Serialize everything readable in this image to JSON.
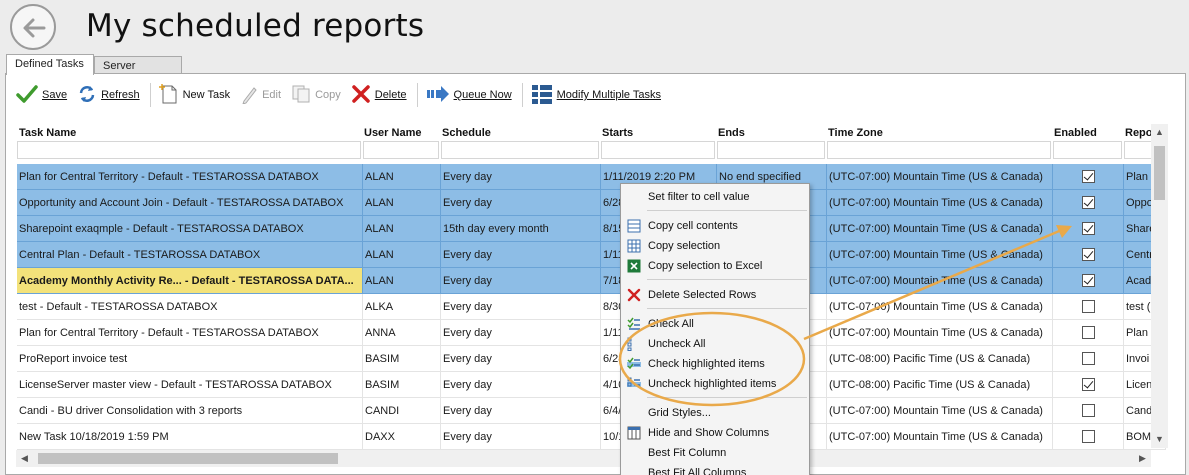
{
  "title": "My scheduled reports",
  "tabs": [
    {
      "label": "Defined Tasks",
      "active": true
    },
    {
      "label": "Server Control",
      "active": false
    }
  ],
  "toolbar": {
    "save": "Save",
    "refresh": "Refresh",
    "new_task": "New Task",
    "edit": "Edit",
    "copy": "Copy",
    "delete": "Delete",
    "queue_now": "Queue Now",
    "modify_multiple": "Modify Multiple Tasks"
  },
  "columns": {
    "task_name": "Task Name",
    "user_name": "User Name",
    "schedule": "Schedule",
    "starts": "Starts",
    "ends": "Ends",
    "time_zone": "Time Zone",
    "enabled": "Enabled",
    "report": "Repo"
  },
  "rows": [
    {
      "task": "Plan for Central Territory - Default - TESTAROSSA DATABOX",
      "user": "ALAN",
      "schedule": "Every day",
      "starts": "1/11/2019 2:20 PM",
      "ends": "No end specified",
      "tz": "(UTC-07:00) Mountain Time (US & Canada)",
      "enabled": true,
      "report": "Plan f",
      "selected": true,
      "focus": false
    },
    {
      "task": "Opportunity and Account Join - Default - TESTAROSSA DATABOX",
      "user": "ALAN",
      "schedule": "Every day",
      "starts": "6/28",
      "ends": "",
      "tz": "(UTC-07:00) Mountain Time (US & Canada)",
      "enabled": true,
      "report": "Oppo",
      "selected": true,
      "focus": false
    },
    {
      "task": "Sharepoint exaqmple - Default - TESTAROSSA DATABOX",
      "user": "ALAN",
      "schedule": "15th day every month",
      "starts": "8/15",
      "ends": "",
      "tz": "(UTC-07:00) Mountain Time (US & Canada)",
      "enabled": true,
      "report": "Share",
      "selected": true,
      "focus": false
    },
    {
      "task": "Central Plan - Default - TESTAROSSA DATABOX",
      "user": "ALAN",
      "schedule": "Every day",
      "starts": "1/11",
      "ends": "",
      "tz": "(UTC-07:00) Mountain Time (US & Canada)",
      "enabled": true,
      "report": "Centr",
      "selected": true,
      "focus": false
    },
    {
      "task": "Academy Monthly Activity Re... - Default - TESTAROSSA DATA...",
      "user": "ALAN",
      "schedule": "Every day",
      "starts": "7/18",
      "ends": "",
      "tz": "(UTC-07:00) Mountain Time (US & Canada)",
      "enabled": true,
      "report": "Acad",
      "selected": true,
      "focus": true
    },
    {
      "task": "test - Default - TESTAROSSA DATABOX",
      "user": "ALKA",
      "schedule": "Every day",
      "starts": "8/30",
      "ends": "",
      "tz": "(UTC-07:00) Mountain Time (US & Canada)",
      "enabled": false,
      "report": "test (",
      "selected": false,
      "focus": false
    },
    {
      "task": "Plan for Central Territory - Default - TESTAROSSA DATABOX",
      "user": "ANNA",
      "schedule": "Every day",
      "starts": "1/11",
      "ends": "",
      "tz": "(UTC-07:00) Mountain Time (US & Canada)",
      "enabled": false,
      "report": "Plan f",
      "selected": false,
      "focus": false
    },
    {
      "task": "ProReport invoice test",
      "user": "BASIM",
      "schedule": "Every day",
      "starts": "6/28",
      "ends": "",
      "tz": "(UTC-08:00) Pacific Time (US & Canada)",
      "enabled": false,
      "report": "Invoi",
      "selected": false,
      "focus": false
    },
    {
      "task": "LicenseServer master view - Default - TESTAROSSA DATABOX",
      "user": "BASIM",
      "schedule": "Every day",
      "starts": "4/10",
      "ends": "",
      "tz": "(UTC-08:00) Pacific Time (US & Canada)",
      "enabled": true,
      "report": "Licen",
      "selected": false,
      "focus": false
    },
    {
      "task": "Candi - BU driver Consolidation with 3 reports",
      "user": "CANDI",
      "schedule": "Every day",
      "starts": "6/4/",
      "ends": "",
      "tz": "(UTC-07:00) Mountain Time (US & Canada)",
      "enabled": false,
      "report": "Cand",
      "selected": false,
      "focus": false
    },
    {
      "task": "New Task 10/18/2019 1:59 PM",
      "user": "DAXX",
      "schedule": "Every day",
      "starts": "10/1",
      "ends": "",
      "tz": "(UTC-07:00) Mountain Time (US & Canada)",
      "enabled": false,
      "report": "BOM",
      "selected": false,
      "focus": false
    }
  ],
  "context_menu": {
    "set_filter": "Set filter to cell value",
    "copy_cell": "Copy cell contents",
    "copy_selection": "Copy selection",
    "copy_excel": "Copy selection to Excel",
    "delete_rows": "Delete Selected Rows",
    "check_all": "Check All",
    "uncheck_all": "Uncheck All",
    "check_highlighted": "Check highlighted items",
    "uncheck_highlighted": "Uncheck highlighted items",
    "grid_styles": "Grid Styles...",
    "hide_show": "Hide and Show Columns",
    "best_fit": "Best Fit Column",
    "best_fit_all": "Best Fit All Columns"
  },
  "colors": {
    "selection": "#8dbde6",
    "focus_row": "#f3e27a",
    "annotation": "#e9a94a"
  }
}
